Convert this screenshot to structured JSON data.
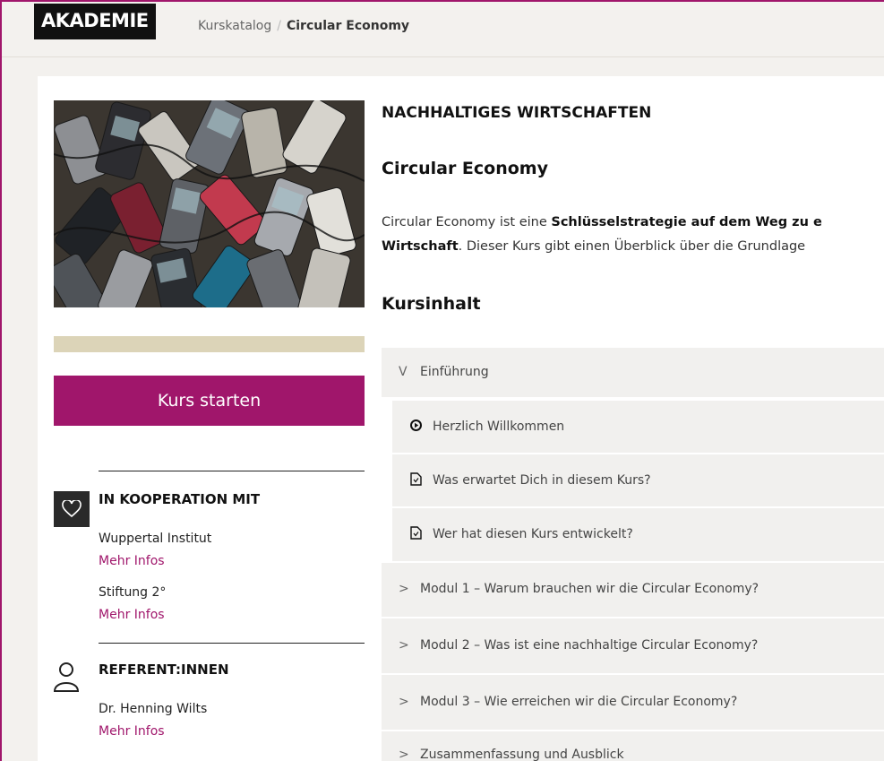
{
  "header": {
    "logo": "AKADEMIE",
    "breadcrumb_root": "Kurskatalog",
    "breadcrumb_separator": "/",
    "breadcrumb_current": "Circular Economy"
  },
  "sidebar": {
    "start_button": "Kurs starten",
    "cooperation_title": "IN KOOPERATION MIT",
    "partners": [
      {
        "name": "Wuppertal Institut",
        "link": "Mehr Infos"
      },
      {
        "name": "Stiftung 2°",
        "link": "Mehr Infos"
      }
    ],
    "speakers_title": "REFERENT:INNEN",
    "speakers": [
      {
        "name": "Dr. Henning Wilts",
        "link": "Mehr Infos"
      }
    ]
  },
  "main": {
    "kicker": "NACHHALTIGES WIRTSCHAFTEN",
    "title": "Circular Economy",
    "desc_part1": "Circular Economy ist eine ",
    "desc_bold1": "Schlüsselstrategie auf dem Weg zu e",
    "desc_bold2": "Wirtschaft",
    "desc_part2": ". Dieser Kurs gibt einen Überblick über die Grundlage",
    "content_title": "Kursinhalt",
    "sections": [
      {
        "chevron": "V",
        "label": "Einführung"
      },
      {
        "chevron": ">",
        "label": "Modul 1 – Warum brauchen wir die Circular Economy?"
      },
      {
        "chevron": ">",
        "label": "Modul 2 – Was ist eine nachhaltige Circular Economy?"
      },
      {
        "chevron": ">",
        "label": "Modul 3 – Wie erreichen wir die Circular Economy?"
      },
      {
        "chevron": ">",
        "label": "Zusammenfassung und Ausblick"
      }
    ],
    "lessons": [
      {
        "icon": "play-circle-icon",
        "label": "Herzlich Willkommen"
      },
      {
        "icon": "document-icon",
        "label": "Was erwartet Dich in diesem Kurs?"
      },
      {
        "icon": "document-icon",
        "label": "Wer hat diesen Kurs entwickelt?"
      }
    ]
  },
  "colors": {
    "brand": "#a0166b",
    "progress_track": "#dcd4b8",
    "accordion_bg": "#f1f0ee"
  }
}
